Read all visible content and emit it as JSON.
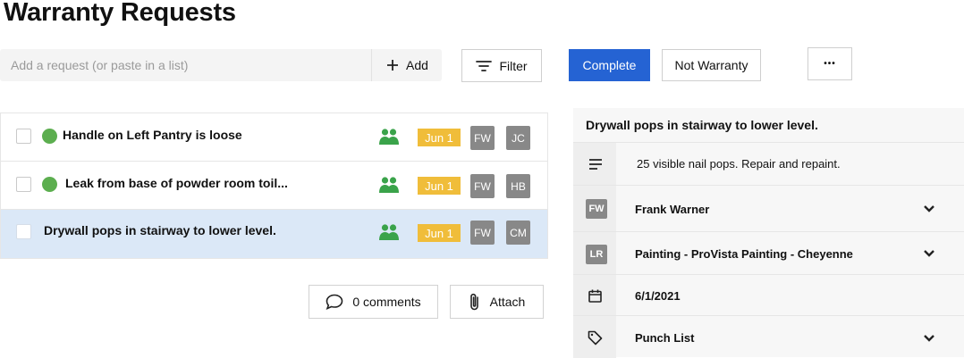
{
  "page": {
    "title": "Warranty Requests"
  },
  "toolbar": {
    "add_placeholder": "Add a request (or paste in a list)",
    "add_label": "Add",
    "filter_label": "Filter",
    "complete_label": "Complete",
    "not_warranty_label": "Not Warranty",
    "more_label": "•••"
  },
  "requests": [
    {
      "label": "Handle on Left Pantry is loose",
      "status_color": "#5cae4f",
      "due": "Jun 1",
      "initials": [
        "FW",
        "JC"
      ]
    },
    {
      "label": "Leak from base of powder room toil...",
      "status_color": "#5cae4f",
      "due": "Jun 1",
      "initials": [
        "FW",
        "HB"
      ]
    },
    {
      "label": "Drywall pops in stairway to lower level.",
      "due": "Jun 1",
      "initials": [
        "FW",
        "CM"
      ],
      "selected": true
    }
  ],
  "actions": {
    "comments_label": "0 comments",
    "attach_label": "Attach"
  },
  "detail": {
    "title": "Drywall pops in stairway to lower level.",
    "description": "25 visible nail pops. Repair and repaint.",
    "assignee": {
      "initials": "FW",
      "name": "Frank Warner"
    },
    "vendor": {
      "initials": "LR",
      "name": "Painting - ProVista Painting - Cheyenne"
    },
    "due_date": "6/1/2021",
    "tag": "Punch List"
  },
  "colors": {
    "primary": "#2563d3",
    "date_badge": "#f0bd3a",
    "selected_row": "#dbe8f7",
    "people_icon": "#3aa34a",
    "avatar": "#888888"
  }
}
